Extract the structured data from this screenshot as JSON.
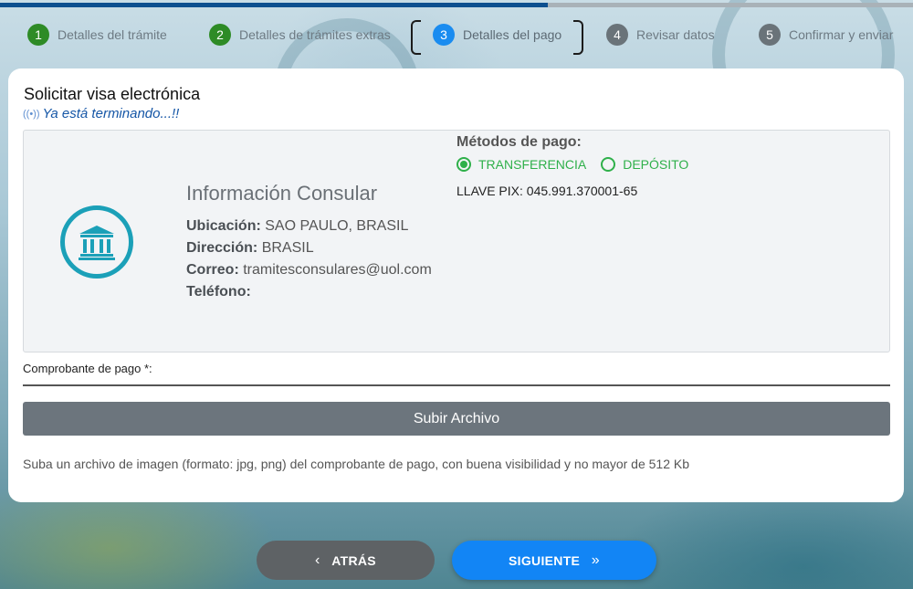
{
  "progress": {
    "fraction": 0.6
  },
  "steps": [
    {
      "num": "1",
      "label": "Detalles del trámite",
      "state": "done"
    },
    {
      "num": "2",
      "label": "Detalles de trámites extras",
      "state": "done"
    },
    {
      "num": "3",
      "label": "Detalles del pago",
      "state": "active"
    },
    {
      "num": "4",
      "label": "Revisar datos",
      "state": "pending"
    },
    {
      "num": "5",
      "label": "Confirmar y enviar",
      "state": "pending"
    }
  ],
  "card": {
    "title": "Solicitar visa electrónica",
    "subtitle": "Ya está terminando...!!"
  },
  "consular": {
    "icon": "bank-icon",
    "title": "Información Consular",
    "ubicacion_label": "Ubicación:",
    "ubicacion_value": "SAO PAULO, BRASIL",
    "direccion_label": "Dirección:",
    "direccion_value": "BRASIL",
    "correo_label": "Correo:",
    "correo_value": "tramitesconsulares@uol.com",
    "telefono_label": "Teléfono:",
    "telefono_value": ""
  },
  "payment": {
    "title": "Métodos de pago:",
    "options": [
      {
        "label": "TRANSFERENCIA",
        "checked": true
      },
      {
        "label": "DEPÓSITO",
        "checked": false
      }
    ],
    "pix": "LLAVE PIX: 045.991.370001-65"
  },
  "upload": {
    "label": "Comprobante de pago *:",
    "button": "Subir Archivo",
    "hint": "Suba un archivo de imagen (formato: jpg, png) del comprobante de pago, con buena visibilidad y no mayor de 512 Kb"
  },
  "nav": {
    "back": "ATRÁS",
    "next": "SIGUIENTE"
  },
  "colors": {
    "done": "#2e8b26",
    "active": "#1a8cf0",
    "pending": "#6a7379",
    "accent_green": "#2fb04a",
    "next_button": "#1285f5"
  }
}
